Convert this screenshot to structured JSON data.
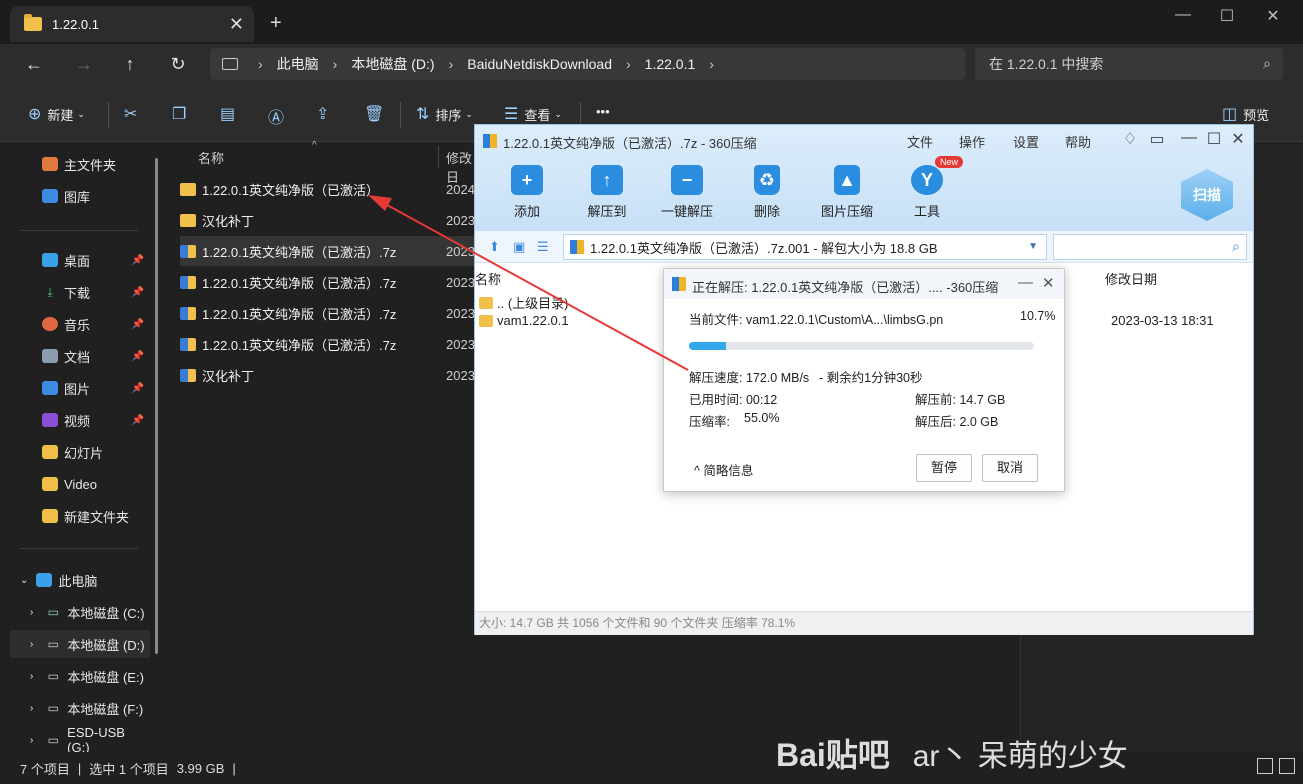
{
  "explorer": {
    "tab_title": "1.22.0.1",
    "tab_close": "✕",
    "tab_new": "+",
    "address": [
      "此电脑",
      "本地磁盘 (D:)",
      "BaiduNetdiskDownload",
      "1.22.0.1"
    ],
    "search_placeholder": "在 1.22.0.1 中搜索",
    "commands": {
      "new": "新建",
      "sort": "排序",
      "view": "查看",
      "more": "•••",
      "preview": "预览"
    },
    "sidebar": {
      "home": "主文件夹",
      "gallery": "图库",
      "desktop": "桌面",
      "downloads": "下载",
      "music": "音乐",
      "documents": "文档",
      "pictures": "图片",
      "videos": "视频",
      "slides": "幻灯片",
      "video": "Video",
      "new_folder": "新建文件夹",
      "this_pc": "此电脑",
      "drive_c": "本地磁盘 (C:)",
      "drive_d": "本地磁盘 (D:)",
      "drive_e": "本地磁盘 (E:)",
      "drive_f": "本地磁盘 (F:)",
      "drive_g": "ESD-USB (G:)"
    },
    "columns": {
      "name": "名称",
      "modified": "修改日"
    },
    "files": [
      {
        "name": "1.22.0.1英文纯净版（已激活）",
        "date": "2024",
        "type": "folder"
      },
      {
        "name": "汉化补丁",
        "date": "2023",
        "type": "folder"
      },
      {
        "name": "1.22.0.1英文纯净版（已激活）.7z",
        "date": "2023",
        "type": "archive"
      },
      {
        "name": "1.22.0.1英文纯净版（已激活）.7z",
        "date": "2023",
        "type": "archive"
      },
      {
        "name": "1.22.0.1英文纯净版（已激活）.7z",
        "date": "2023",
        "type": "archive"
      },
      {
        "name": "1.22.0.1英文纯净版（已激活）.7z",
        "date": "2023",
        "type": "archive"
      },
      {
        "name": "汉化补丁",
        "date": "2023",
        "type": "archive"
      }
    ],
    "status": {
      "count": "7 个项目",
      "selected": "选中 1 个项目",
      "size": "3.99 GB",
      "sep": "|"
    }
  },
  "zip": {
    "title": "1.22.0.1英文纯净版（已激活）.7z - 360压缩",
    "menu": [
      "文件",
      "操作",
      "设置",
      "帮助"
    ],
    "tools": {
      "add": "添加",
      "extract_to": "解压到",
      "one_click": "一键解压",
      "delete": "删除",
      "image_compress": "图片压缩",
      "tools": "工具",
      "new_badge": "New"
    },
    "scan": "扫描",
    "path": "1.22.0.1英文纯净版（已激活）.7z.001 - 解包大小为 18.8 GB",
    "list_header": {
      "name": "名称",
      "modified": "修改日期"
    },
    "rows": [
      {
        "name": ".. (上级目录)"
      },
      {
        "name": "vam1.22.0.1",
        "date": "2023-03-13 18:31"
      }
    ],
    "status": "大小: 14.7 GB 共 1056 个文件和 90 个文件夹 压缩率 78.1%"
  },
  "dialog": {
    "title": "正在解压: 1.22.0.1英文纯净版（已激活）.... -360压缩",
    "current_file": "当前文件: vam1.22.0.1\\Custom\\A...\\limbsG.pn",
    "percent": "10.7%",
    "progress": 10.7,
    "speed": "解压速度: 172.0 MB/s",
    "remaining": "- 剩余约1分钟30秒",
    "elapsed": "已用时间: 00:12",
    "before": "解压前: 14.7 GB",
    "ratio_label": "压缩率:",
    "ratio_value": "55.0%",
    "after": "解压后: 2.0 GB",
    "brief": "简略信息",
    "pause": "暂停",
    "cancel": "取消"
  },
  "watermark": {
    "brand": "Bai贴吧",
    "user": "ar丶 呆萌的少女"
  },
  "colors": {
    "accent": "#32a7ea",
    "arrow": "#e53935",
    "folder": "#f0c04a"
  }
}
